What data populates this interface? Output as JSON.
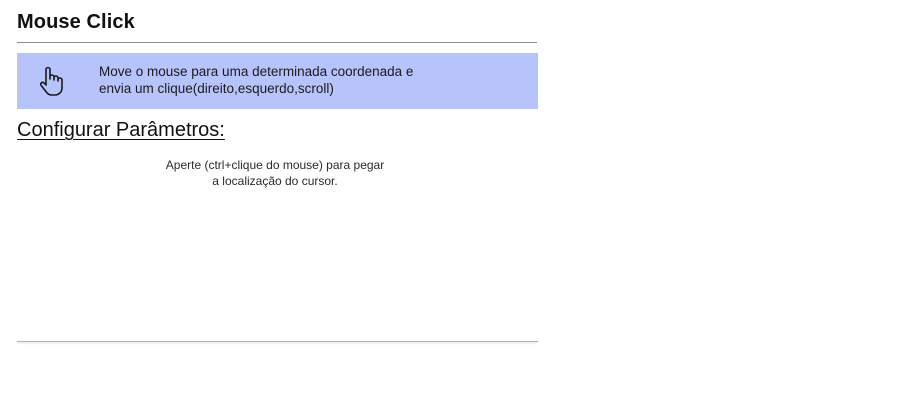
{
  "header": {
    "title": "Mouse Click"
  },
  "description": {
    "icon": "hand-pointer-icon",
    "line1": "Move o mouse para uma determinada coordenada e",
    "line2": "envia um clique(direito,esquerdo,scroll)",
    "background_color": "#b7c4fc"
  },
  "parameters": {
    "heading": "Configurar Parâmetros:",
    "hint_line1": "Aperte (ctrl+clique do mouse) para pegar",
    "hint_line2": "a localização do cursor."
  }
}
